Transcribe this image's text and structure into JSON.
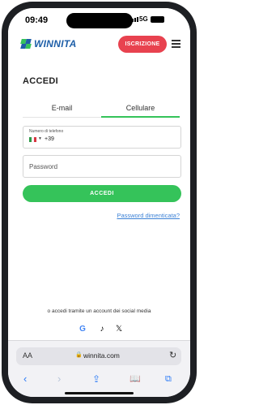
{
  "status_bar": {
    "time": "09:49",
    "network": "5G"
  },
  "header": {
    "brand": "WINNITA",
    "register_label": "ISCRIZIONE"
  },
  "login": {
    "title": "ACCEDI",
    "tabs": [
      {
        "label": "E-mail"
      },
      {
        "label": "Cellulare"
      }
    ],
    "active_tab": "Cellulare",
    "phone": {
      "label": "Numero di telefono",
      "prefix": "+39",
      "country": "Italy"
    },
    "password": {
      "placeholder": "Password"
    },
    "submit_label": "ACCEDI",
    "forgot_label": "Password dimenticata?",
    "social_prompt": "o accedi tramite un account dei social media",
    "social_icons": [
      "google-icon",
      "tiktok-icon",
      "x-icon"
    ]
  },
  "browser": {
    "text_size": "AA",
    "url": "winnita.com"
  },
  "colors": {
    "brand_blue": "#1e5fa8",
    "register_red": "#e8424f",
    "accent_green": "#35c35a",
    "link_blue": "#3d82d6"
  }
}
